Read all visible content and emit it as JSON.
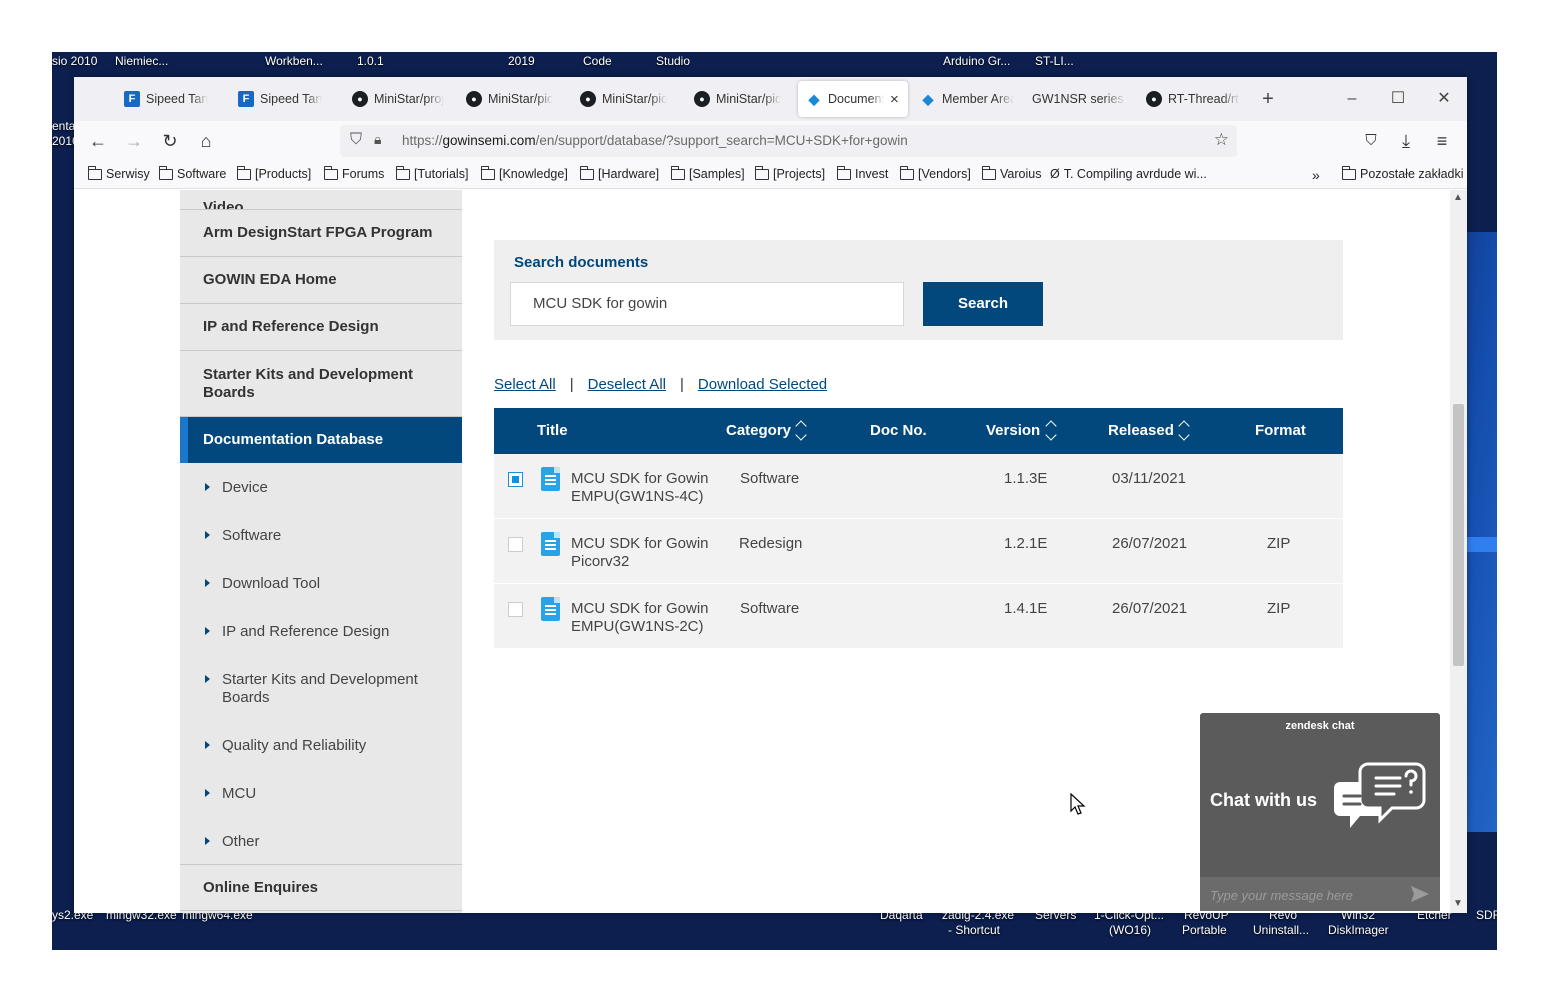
{
  "desktop": {
    "top_labels": [
      "sio 2010",
      "Niemiec...",
      "Workben...",
      "1.0.1",
      "2019",
      "Code",
      "Studio",
      "Arduino Gr...",
      "ST-LI..."
    ],
    "left_labels": [
      "enta",
      "2016"
    ],
    "bottom_labels": [
      "sys2.exe",
      "mingw32.exe",
      "mingw64.exe",
      "Daqarta",
      "zadig-2.4.exe",
      "- Shortcut",
      "Servers",
      "1-Click-Opt...",
      "(WO16)",
      "RevoUP",
      "Portable",
      "Revo",
      "Uninstall...",
      "Win32",
      "DiskImager",
      "Etcher",
      "SDF"
    ]
  },
  "browser": {
    "tabs": [
      {
        "label": "Sipeed Tan",
        "icon": "fav-f"
      },
      {
        "label": "Sipeed Tan",
        "icon": "fav-f"
      },
      {
        "label": "MiniStar/proj",
        "icon": "github-icon"
      },
      {
        "label": "MiniStar/pic",
        "icon": "github-icon"
      },
      {
        "label": "MiniStar/pic",
        "icon": "github-icon"
      },
      {
        "label": "MiniStar/pic",
        "icon": "github-icon"
      },
      {
        "label": "Document",
        "icon": "gowin-icon",
        "active": true
      },
      {
        "label": "Member Area",
        "icon": "gowin-icon"
      },
      {
        "label": "GW1NSR series of",
        "icon": ""
      },
      {
        "label": "RT-Thread/rt-",
        "icon": "github-icon"
      }
    ],
    "url_prefix": "https://",
    "url_domain": "gowinsemi.com",
    "url_rest": "/en/support/database/?support_search=MCU+SDK+for+gowin",
    "bookmarks": [
      "Serwisy",
      "Software",
      "[Products]",
      "Forums",
      "[Tutorials]",
      "[Knowledge]",
      "[Hardware]",
      "[Samples]",
      "[Projects]",
      "Invest",
      "[Vendors]",
      "Varoius",
      "T. Compiling avrdude wi..."
    ],
    "other_bookmarks": "Pozostałe zakładki"
  },
  "sidebar": {
    "top_partial": "Video",
    "items": [
      "Arm DesignStart FPGA Program",
      "GOWIN EDA Home",
      "IP and Reference Design",
      "Starter Kits and Development Boards",
      "Documentation Database"
    ],
    "subitems": [
      "Device",
      "Software",
      "Download Tool",
      "IP and Reference Design",
      "Starter Kits and Development Boards",
      "Quality and Reliability",
      "MCU",
      "Other"
    ],
    "footer_item": "Online Enquires"
  },
  "search": {
    "label": "Search documents",
    "value": "MCU SDK for gowin",
    "button": "Search"
  },
  "actions": {
    "select_all": "Select All",
    "deselect_all": "Deselect All",
    "download_selected": "Download Selected",
    "separator": "|"
  },
  "table": {
    "columns": [
      "Title",
      "Category",
      "Doc No.",
      "Version",
      "Released",
      "Format"
    ],
    "rows": [
      {
        "title": "MCU SDK for Gowin EMPU(GW1NS-4C)",
        "category": "Software",
        "doc_no": "",
        "version": "1.1.3E",
        "released": "03/11/2021",
        "format": "",
        "checked": true
      },
      {
        "title": "MCU SDK for Gowin Picorv32",
        "category": "Redesign",
        "doc_no": "",
        "version": "1.2.1E",
        "released": "26/07/2021",
        "format": "ZIP",
        "checked": false
      },
      {
        "title": "MCU SDK for Gowin EMPU(GW1NS-2C)",
        "category": "Software",
        "doc_no": "",
        "version": "1.4.1E",
        "released": "26/07/2021",
        "format": "ZIP",
        "checked": false
      }
    ]
  },
  "chat": {
    "brand": "zendesk chat",
    "cta": "Chat with us",
    "placeholder": "Type your message here"
  }
}
